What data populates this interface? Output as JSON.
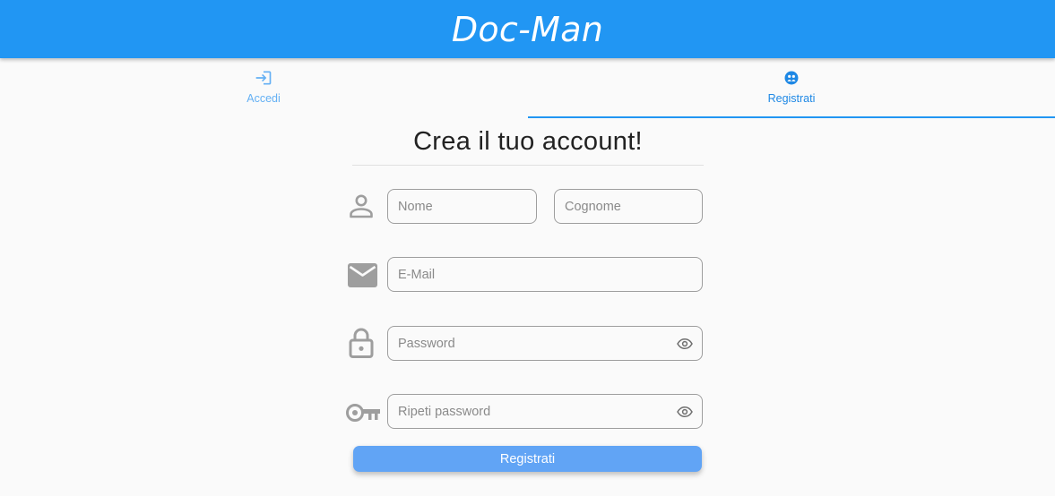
{
  "app": {
    "title": "Doc-Man"
  },
  "tabs": [
    {
      "label": "Accedi",
      "icon": "login-icon",
      "active": false
    },
    {
      "label": "Registrati",
      "icon": "register-icon",
      "active": true
    }
  ],
  "form": {
    "heading": "Crea il tuo account!",
    "first_name": {
      "placeholder": "Nome",
      "value": ""
    },
    "last_name": {
      "placeholder": "Cognome",
      "value": ""
    },
    "email": {
      "placeholder": "E-Mail",
      "value": ""
    },
    "password": {
      "placeholder": "Password",
      "value": ""
    },
    "repeat_password": {
      "placeholder": "Ripeti password",
      "value": ""
    },
    "submit_label": "Registrati"
  },
  "icons": {
    "person": "person-icon",
    "mail": "mail-icon",
    "lock": "lock-icon",
    "key": "key-icon",
    "eye": "eye-icon"
  },
  "colors": {
    "appbar": "#2196f3",
    "accent": "#1e88e5",
    "button": "#61a4f5",
    "icon_gray": "#9e9e9e"
  }
}
